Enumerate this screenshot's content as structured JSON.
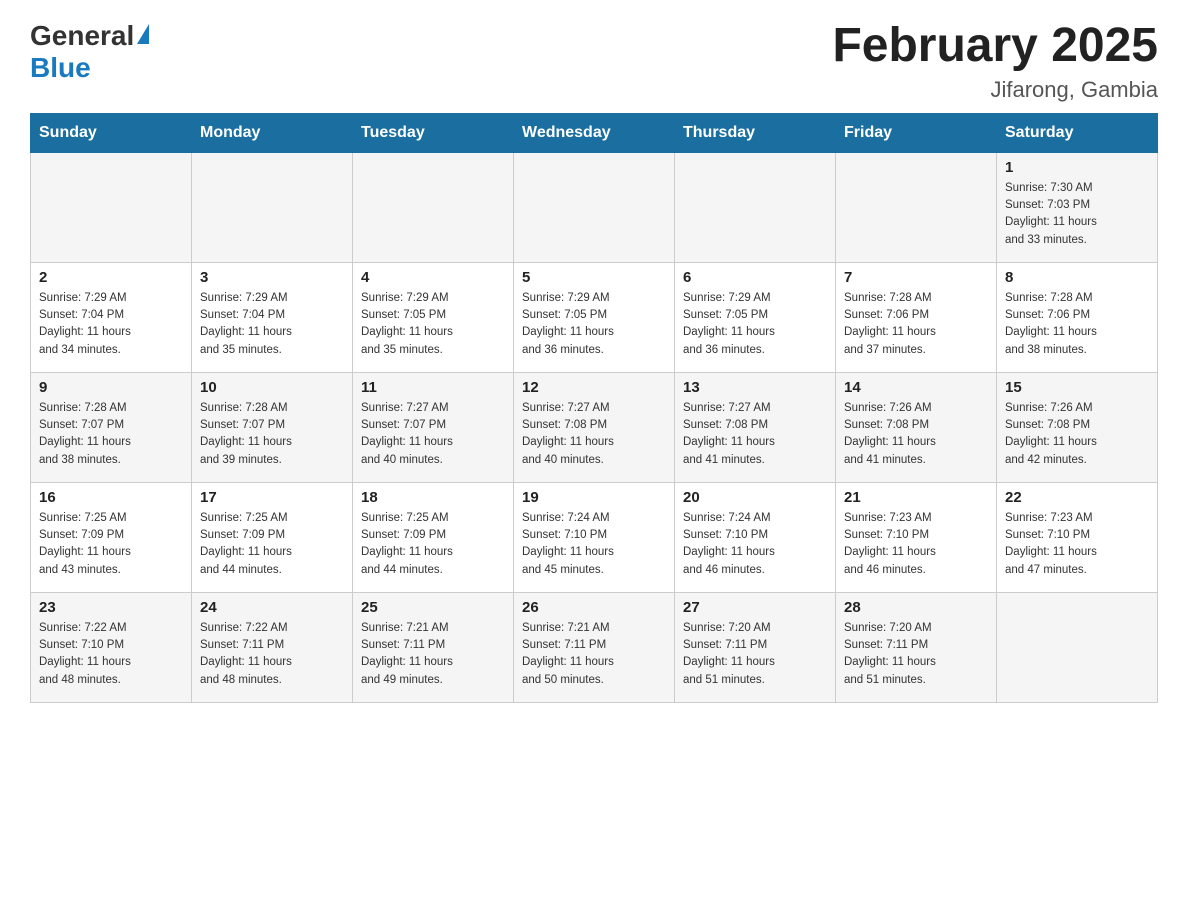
{
  "header": {
    "logo_general": "General",
    "logo_blue": "Blue",
    "month_title": "February 2025",
    "location": "Jifarong, Gambia"
  },
  "weekdays": [
    "Sunday",
    "Monday",
    "Tuesday",
    "Wednesday",
    "Thursday",
    "Friday",
    "Saturday"
  ],
  "weeks": [
    [
      {
        "day": "",
        "info": ""
      },
      {
        "day": "",
        "info": ""
      },
      {
        "day": "",
        "info": ""
      },
      {
        "day": "",
        "info": ""
      },
      {
        "day": "",
        "info": ""
      },
      {
        "day": "",
        "info": ""
      },
      {
        "day": "1",
        "info": "Sunrise: 7:30 AM\nSunset: 7:03 PM\nDaylight: 11 hours\nand 33 minutes."
      }
    ],
    [
      {
        "day": "2",
        "info": "Sunrise: 7:29 AM\nSunset: 7:04 PM\nDaylight: 11 hours\nand 34 minutes."
      },
      {
        "day": "3",
        "info": "Sunrise: 7:29 AM\nSunset: 7:04 PM\nDaylight: 11 hours\nand 35 minutes."
      },
      {
        "day": "4",
        "info": "Sunrise: 7:29 AM\nSunset: 7:05 PM\nDaylight: 11 hours\nand 35 minutes."
      },
      {
        "day": "5",
        "info": "Sunrise: 7:29 AM\nSunset: 7:05 PM\nDaylight: 11 hours\nand 36 minutes."
      },
      {
        "day": "6",
        "info": "Sunrise: 7:29 AM\nSunset: 7:05 PM\nDaylight: 11 hours\nand 36 minutes."
      },
      {
        "day": "7",
        "info": "Sunrise: 7:28 AM\nSunset: 7:06 PM\nDaylight: 11 hours\nand 37 minutes."
      },
      {
        "day": "8",
        "info": "Sunrise: 7:28 AM\nSunset: 7:06 PM\nDaylight: 11 hours\nand 38 minutes."
      }
    ],
    [
      {
        "day": "9",
        "info": "Sunrise: 7:28 AM\nSunset: 7:07 PM\nDaylight: 11 hours\nand 38 minutes."
      },
      {
        "day": "10",
        "info": "Sunrise: 7:28 AM\nSunset: 7:07 PM\nDaylight: 11 hours\nand 39 minutes."
      },
      {
        "day": "11",
        "info": "Sunrise: 7:27 AM\nSunset: 7:07 PM\nDaylight: 11 hours\nand 40 minutes."
      },
      {
        "day": "12",
        "info": "Sunrise: 7:27 AM\nSunset: 7:08 PM\nDaylight: 11 hours\nand 40 minutes."
      },
      {
        "day": "13",
        "info": "Sunrise: 7:27 AM\nSunset: 7:08 PM\nDaylight: 11 hours\nand 41 minutes."
      },
      {
        "day": "14",
        "info": "Sunrise: 7:26 AM\nSunset: 7:08 PM\nDaylight: 11 hours\nand 41 minutes."
      },
      {
        "day": "15",
        "info": "Sunrise: 7:26 AM\nSunset: 7:08 PM\nDaylight: 11 hours\nand 42 minutes."
      }
    ],
    [
      {
        "day": "16",
        "info": "Sunrise: 7:25 AM\nSunset: 7:09 PM\nDaylight: 11 hours\nand 43 minutes."
      },
      {
        "day": "17",
        "info": "Sunrise: 7:25 AM\nSunset: 7:09 PM\nDaylight: 11 hours\nand 44 minutes."
      },
      {
        "day": "18",
        "info": "Sunrise: 7:25 AM\nSunset: 7:09 PM\nDaylight: 11 hours\nand 44 minutes."
      },
      {
        "day": "19",
        "info": "Sunrise: 7:24 AM\nSunset: 7:10 PM\nDaylight: 11 hours\nand 45 minutes."
      },
      {
        "day": "20",
        "info": "Sunrise: 7:24 AM\nSunset: 7:10 PM\nDaylight: 11 hours\nand 46 minutes."
      },
      {
        "day": "21",
        "info": "Sunrise: 7:23 AM\nSunset: 7:10 PM\nDaylight: 11 hours\nand 46 minutes."
      },
      {
        "day": "22",
        "info": "Sunrise: 7:23 AM\nSunset: 7:10 PM\nDaylight: 11 hours\nand 47 minutes."
      }
    ],
    [
      {
        "day": "23",
        "info": "Sunrise: 7:22 AM\nSunset: 7:10 PM\nDaylight: 11 hours\nand 48 minutes."
      },
      {
        "day": "24",
        "info": "Sunrise: 7:22 AM\nSunset: 7:11 PM\nDaylight: 11 hours\nand 48 minutes."
      },
      {
        "day": "25",
        "info": "Sunrise: 7:21 AM\nSunset: 7:11 PM\nDaylight: 11 hours\nand 49 minutes."
      },
      {
        "day": "26",
        "info": "Sunrise: 7:21 AM\nSunset: 7:11 PM\nDaylight: 11 hours\nand 50 minutes."
      },
      {
        "day": "27",
        "info": "Sunrise: 7:20 AM\nSunset: 7:11 PM\nDaylight: 11 hours\nand 51 minutes."
      },
      {
        "day": "28",
        "info": "Sunrise: 7:20 AM\nSunset: 7:11 PM\nDaylight: 11 hours\nand 51 minutes."
      },
      {
        "day": "",
        "info": ""
      }
    ]
  ]
}
